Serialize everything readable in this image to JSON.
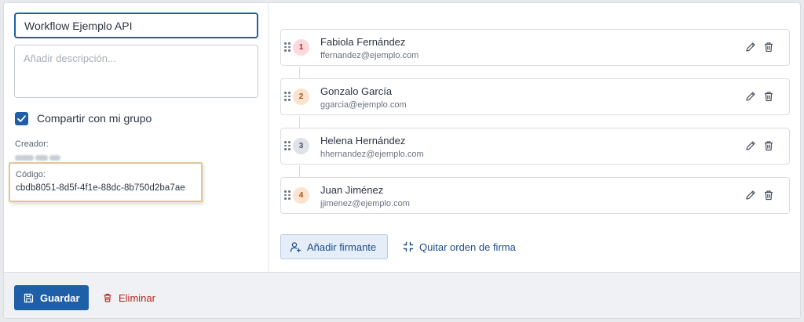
{
  "form": {
    "name_value": "Workflow Ejemplo API",
    "description_placeholder": "Añadir descripción...",
    "share_label": "Compartir con mi grupo",
    "share_checked": true,
    "creator_label": "Creador:",
    "code_label": "Código:",
    "code_value": "cbdb8051-8d5f-4f1e-88dc-8b750d2ba7ae"
  },
  "signers": [
    {
      "order": "1",
      "name": "Fabiola Fernández",
      "email": "ffernandez@ejemplo.com",
      "badge_bg": "#fbd9dc",
      "badge_fg": "#b3261e"
    },
    {
      "order": "2",
      "name": "Gonzalo García",
      "email": "ggarcia@ejemplo.com",
      "badge_bg": "#fbe3cf",
      "badge_fg": "#a6531a"
    },
    {
      "order": "3",
      "name": "Helena Hernández",
      "email": "hhernandez@ejemplo.com",
      "badge_bg": "#dfe2e6",
      "badge_fg": "#4a525e"
    },
    {
      "order": "4",
      "name": "Juan Jiménez",
      "email": "jjimenez@ejemplo.com",
      "badge_bg": "#fbe3cf",
      "badge_fg": "#a6531a"
    }
  ],
  "actions": {
    "add_signer_label": "Añadir firmante",
    "remove_order_label": "Quitar orden de firma",
    "save_label": "Guardar",
    "delete_label": "Eliminar"
  },
  "colors": {
    "primary": "#1f5fa8",
    "danger": "#b3261e",
    "highlight_border": "#e3c595"
  },
  "icons": {
    "drag": "drag-handle-icon",
    "edit": "pencil-icon",
    "delete": "trash-icon",
    "add_signer": "person-plus-icon",
    "remove_order": "collapse-icon",
    "save": "floppy-disk-icon",
    "check": "check-icon"
  }
}
